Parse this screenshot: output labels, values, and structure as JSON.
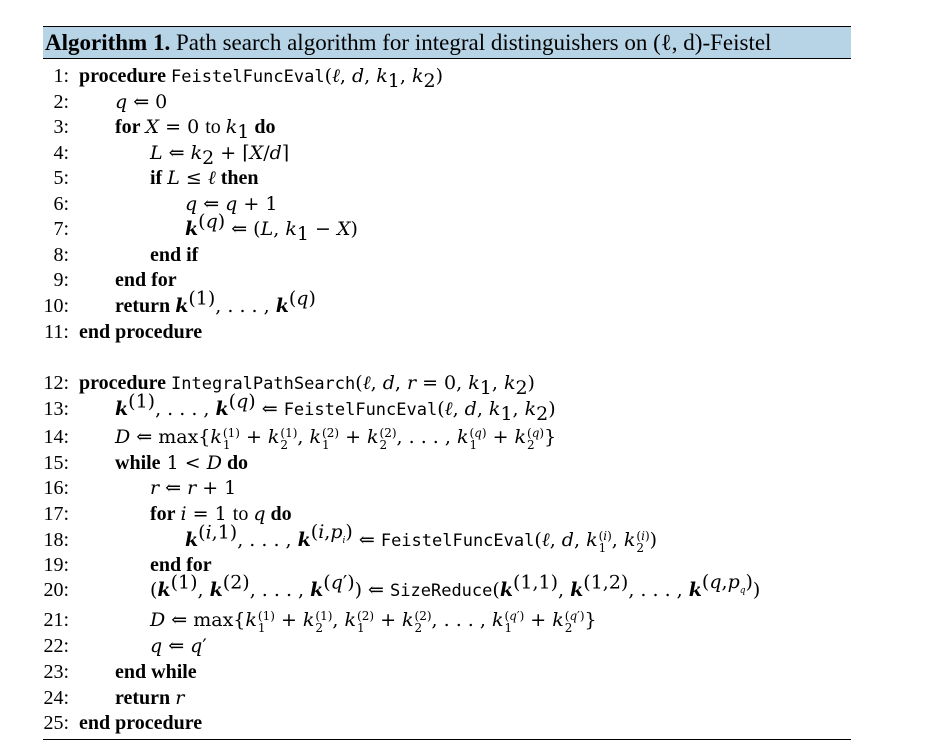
{
  "caption": {
    "label": "Algorithm 1.",
    "title": "Path search algorithm for integral distinguishers on (ℓ, d)-Feistel"
  },
  "keywords": {
    "procedure": "procedure",
    "end_procedure": "end procedure",
    "for": "for",
    "to": "to",
    "do": "do",
    "end_for": "end for",
    "if": "if",
    "then": "then",
    "end_if": "end if",
    "return": "return",
    "while": "while",
    "end_while": "end while"
  },
  "line_numbers": [
    "1:",
    "2:",
    "3:",
    "4:",
    "5:",
    "6:",
    "7:",
    "8:",
    "9:",
    "10:",
    "11:",
    "12:",
    "13:",
    "14:",
    "15:",
    "16:",
    "17:",
    "18:",
    "19:",
    "20:",
    "21:",
    "22:",
    "23:",
    "24:",
    "25:"
  ],
  "functions": {
    "feistel": "FeistelFuncEval",
    "integral": "IntegralPathSearch",
    "reduce": "SizeReduce"
  }
}
